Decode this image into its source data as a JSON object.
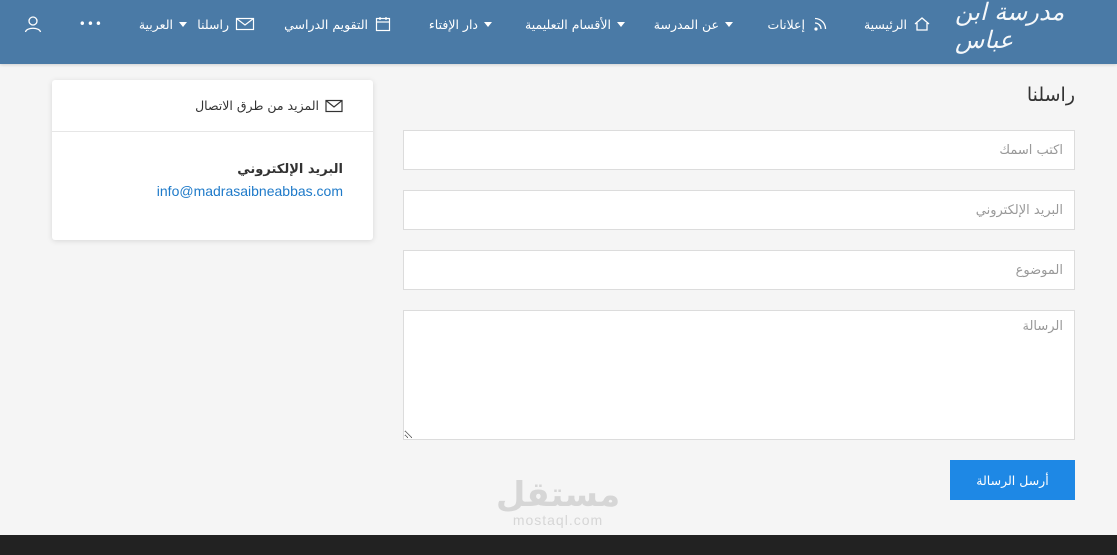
{
  "nav": {
    "logo_text": "مدرسة ابن عباس",
    "home": "الرئيسية",
    "announcements": "إعلانات",
    "about": "عن المدرسة",
    "departments": "الأقسام التعليمية",
    "fatwa": "دار الإفتاء",
    "calendar": "التقويم الدراسي",
    "contact": "راسلنا",
    "language": "العربية",
    "more": "•••"
  },
  "page": {
    "title": "راسلنا"
  },
  "form": {
    "name_placeholder": "اكتب اسمك",
    "email_placeholder": "البريد الإلكتروني",
    "subject_placeholder": "الموضوع",
    "message_placeholder": "الرسالة",
    "submit_label": "أرسل الرسالة"
  },
  "contact_card": {
    "heading": "المزيد من طرق الاتصال",
    "email_label": "البريد الإلكتروني",
    "email_value": "info@madrasaibneabbas.com"
  },
  "watermark": {
    "arabic": "مستقل",
    "latin": "mostaql.com"
  },
  "colors": {
    "header_bg": "#4a7aa6",
    "accent": "#1e88e5",
    "link": "#1e7ac9"
  }
}
